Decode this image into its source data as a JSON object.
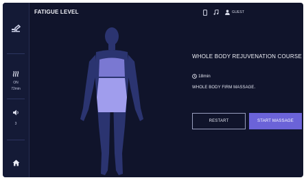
{
  "header": {
    "title": "FATIGUE LEVEL"
  },
  "topbar": {
    "user_label": "GUEST"
  },
  "sidebar": {
    "heat": {
      "status": "ON",
      "level": "72min"
    },
    "volume": {
      "value": "3"
    }
  },
  "course": {
    "title": "WHOLE BODY REJUVENATION COURSE",
    "duration": "18min",
    "description": "WHOLE BODY FIRM MASSAGE."
  },
  "buttons": {
    "restart": "RESTART",
    "start": "START MASSAGE"
  },
  "colors": {
    "background": "#10142b",
    "sidebar": "#141a36",
    "accent": "#6b63d8",
    "body_silhouette": "#2b3470",
    "body_highlight": "#9a98ec"
  },
  "icons": [
    "recline-icon",
    "heat-icon",
    "volume-icon",
    "home-icon",
    "phone-icon",
    "music-icon",
    "user-icon",
    "clock-icon"
  ]
}
